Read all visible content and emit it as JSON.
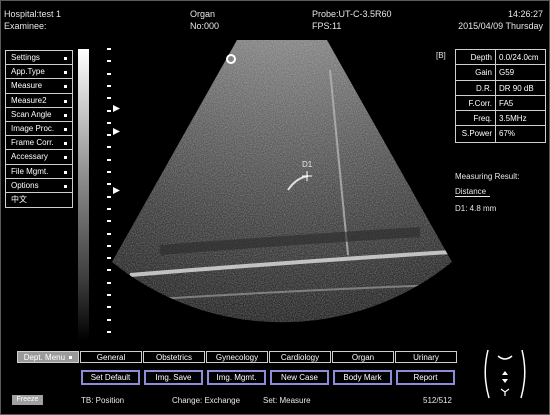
{
  "header": {
    "hospital": "Hospital:test 1",
    "examinee": "Examinee:",
    "app": "Organ",
    "number": "No:000",
    "probe": "Probe:UT-C-3.5R60",
    "fps": "FPS:11",
    "time": "14:26:27",
    "date": "2015/04/09 Thursday"
  },
  "menu": {
    "items": [
      {
        "label": "Settings",
        "dot": true
      },
      {
        "label": "App.Type",
        "dot": true
      },
      {
        "label": "Measure",
        "dot": true
      },
      {
        "label": "Measure2",
        "dot": true
      },
      {
        "label": "Scan Angle",
        "dot": true
      },
      {
        "label": "Image Proc.",
        "dot": true
      },
      {
        "label": "Frame Corr.",
        "dot": true
      },
      {
        "label": "Accessary",
        "dot": true
      },
      {
        "label": "File Mgmt.",
        "dot": true
      },
      {
        "label": "Options",
        "dot": true
      },
      {
        "label": "中文",
        "dot": false
      }
    ]
  },
  "image": {
    "mode_tag": "[B]",
    "cursor_label": "D1"
  },
  "params": [
    {
      "label": "Depth",
      "value": "0.0/24.0cm"
    },
    {
      "label": "Gain",
      "value": "G59"
    },
    {
      "label": "D.R.",
      "value": "DR 90 dB"
    },
    {
      "label": "F.Corr.",
      "value": "FA5"
    },
    {
      "label": "Freq.",
      "value": "3.5MHz"
    },
    {
      "label": "S.Power",
      "value": "67%"
    }
  ],
  "measure": {
    "title": "Measuring Result:",
    "type": "Distance",
    "result": "D1: 4.8 mm"
  },
  "tabs": {
    "menu_label": "Dept. Menu",
    "items": [
      "General",
      "Obstetrics",
      "Gynecology",
      "Cardiology",
      "Organ",
      "Urinary"
    ]
  },
  "buttons": [
    "Set Default",
    "Img. Save",
    "Img. Mgmt.",
    "New Case",
    "Body Mark",
    "Report"
  ],
  "status": {
    "freeze": "Freeze",
    "tb": "TB: Position",
    "change": "Change: Exchange",
    "set": "Set: Measure",
    "frames": "512/512"
  },
  "colors": {
    "background": "#000000",
    "button_border": "#8c8cd8",
    "active_tab": "#9a9a9a"
  }
}
